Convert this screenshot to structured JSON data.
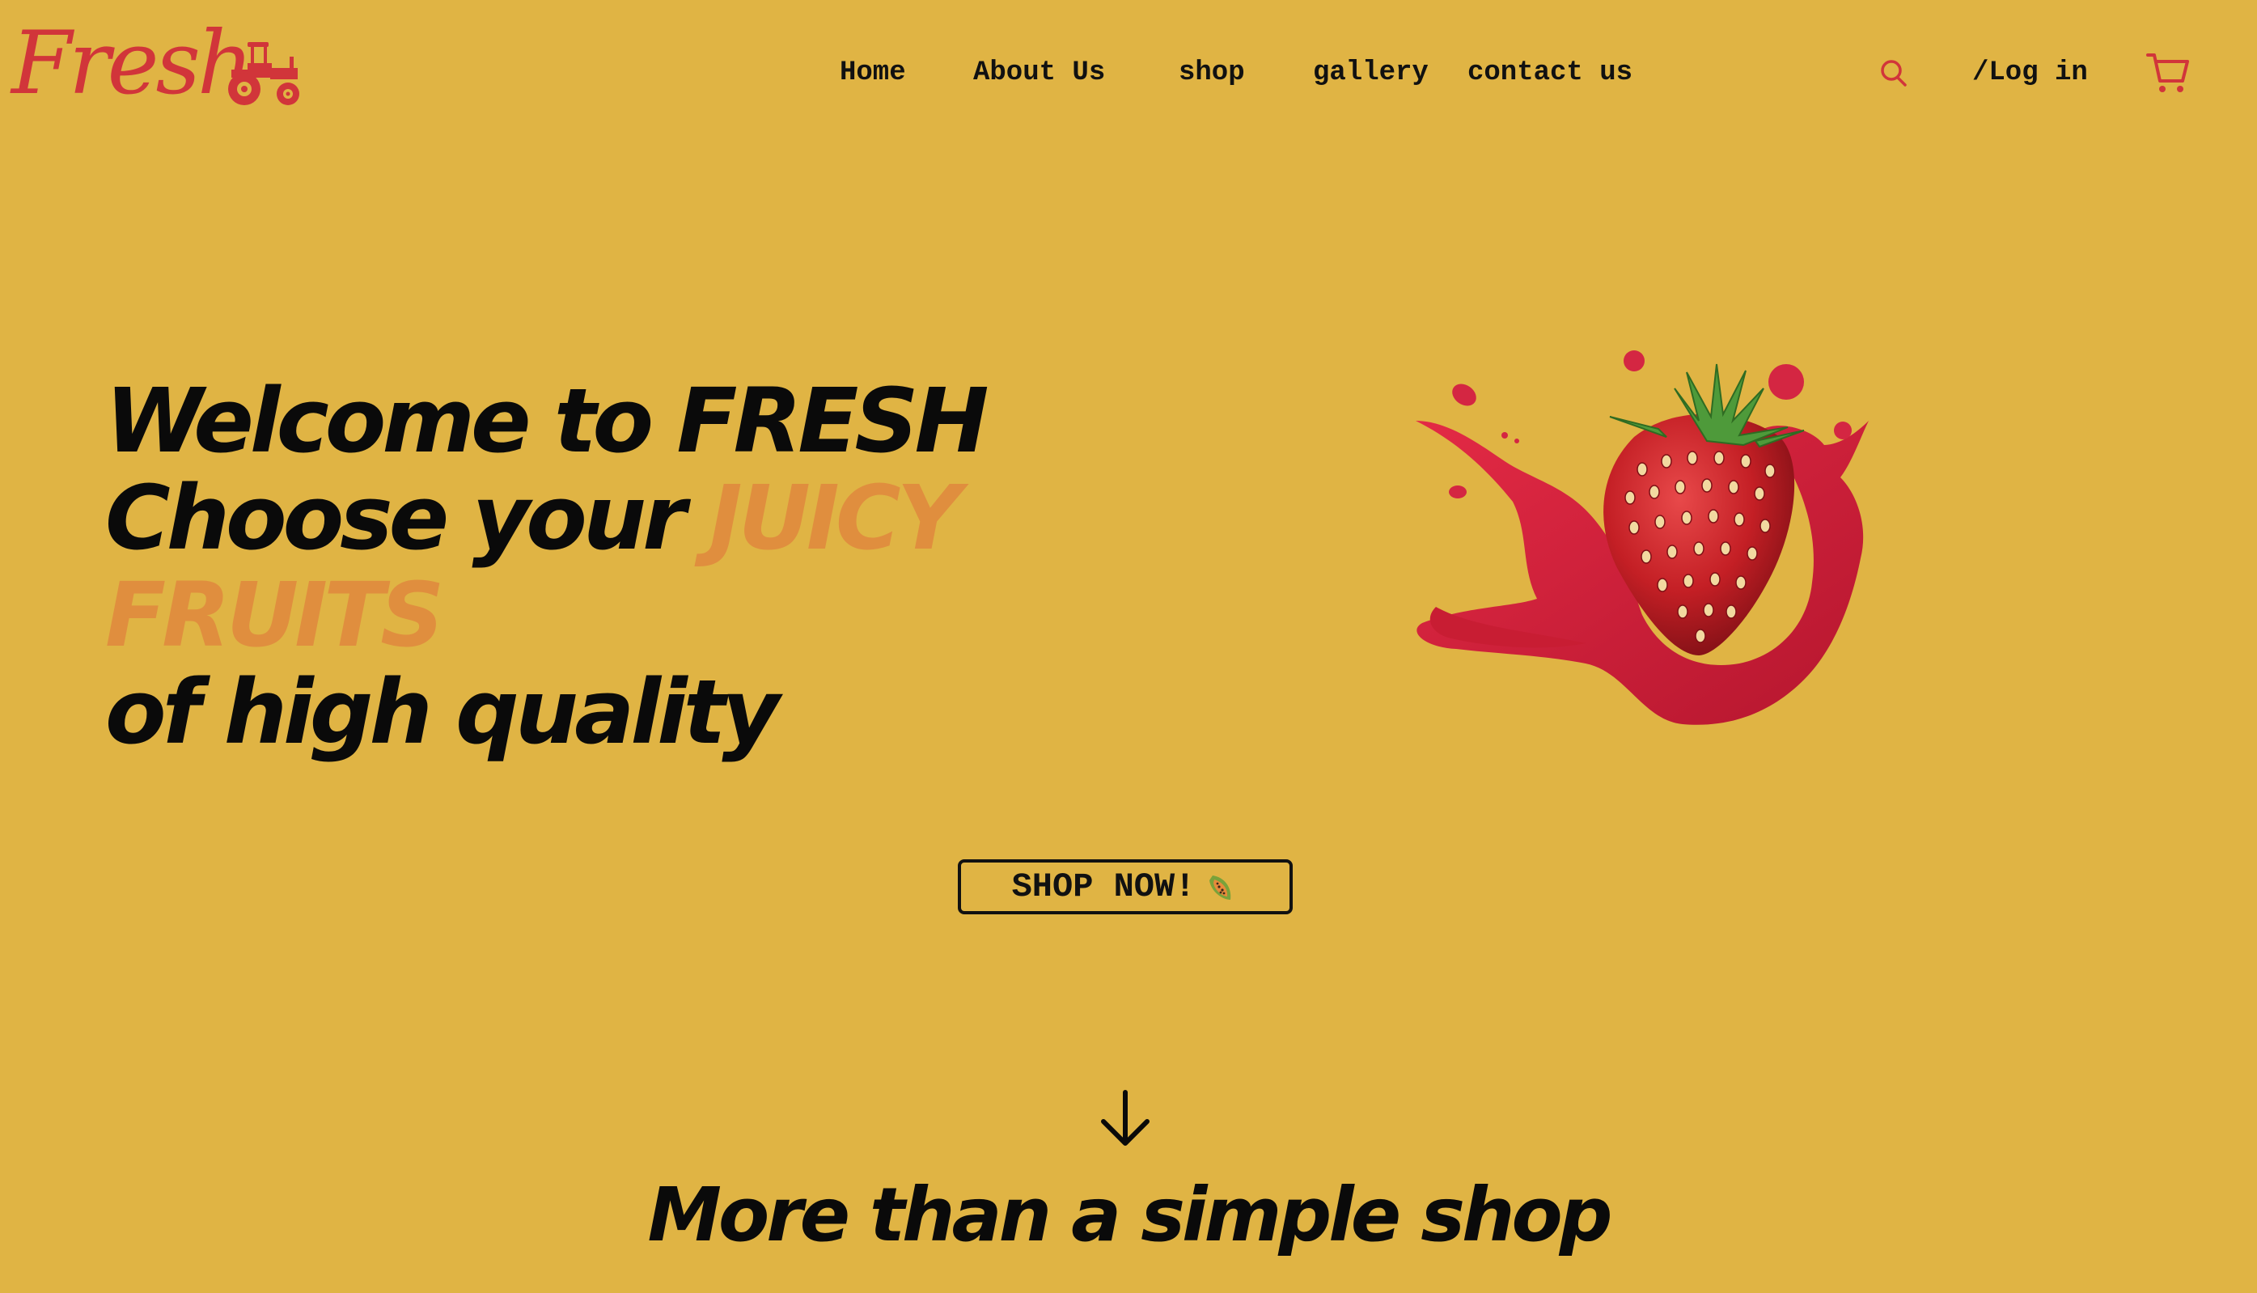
{
  "brand": {
    "logo_text": "Fresh",
    "color": "#d1353a"
  },
  "nav": {
    "items": [
      {
        "label": "Home"
      },
      {
        "label": "About Us"
      },
      {
        "label": "shop"
      },
      {
        "label": "gallery"
      },
      {
        "label": "contact us"
      }
    ],
    "search_icon": "search-icon",
    "login_label": "/Log in",
    "cart_icon": "cart-icon"
  },
  "hero": {
    "line1": "Welcome to FRESH",
    "line2_prefix": "Choose your ",
    "line2_accent": "JUICY",
    "line3_accent": "FRUITS",
    "line4": "of high quality",
    "accent_color": "#e08e3e",
    "image": "strawberry-splash-image"
  },
  "cta": {
    "label": "SHOP NOW!",
    "icon": "papaya-icon"
  },
  "scroll_icon": "arrow-down-icon",
  "section": {
    "title": "More than a simple shop"
  },
  "colors": {
    "background": "#e0b444",
    "text": "#0a0a0a"
  }
}
